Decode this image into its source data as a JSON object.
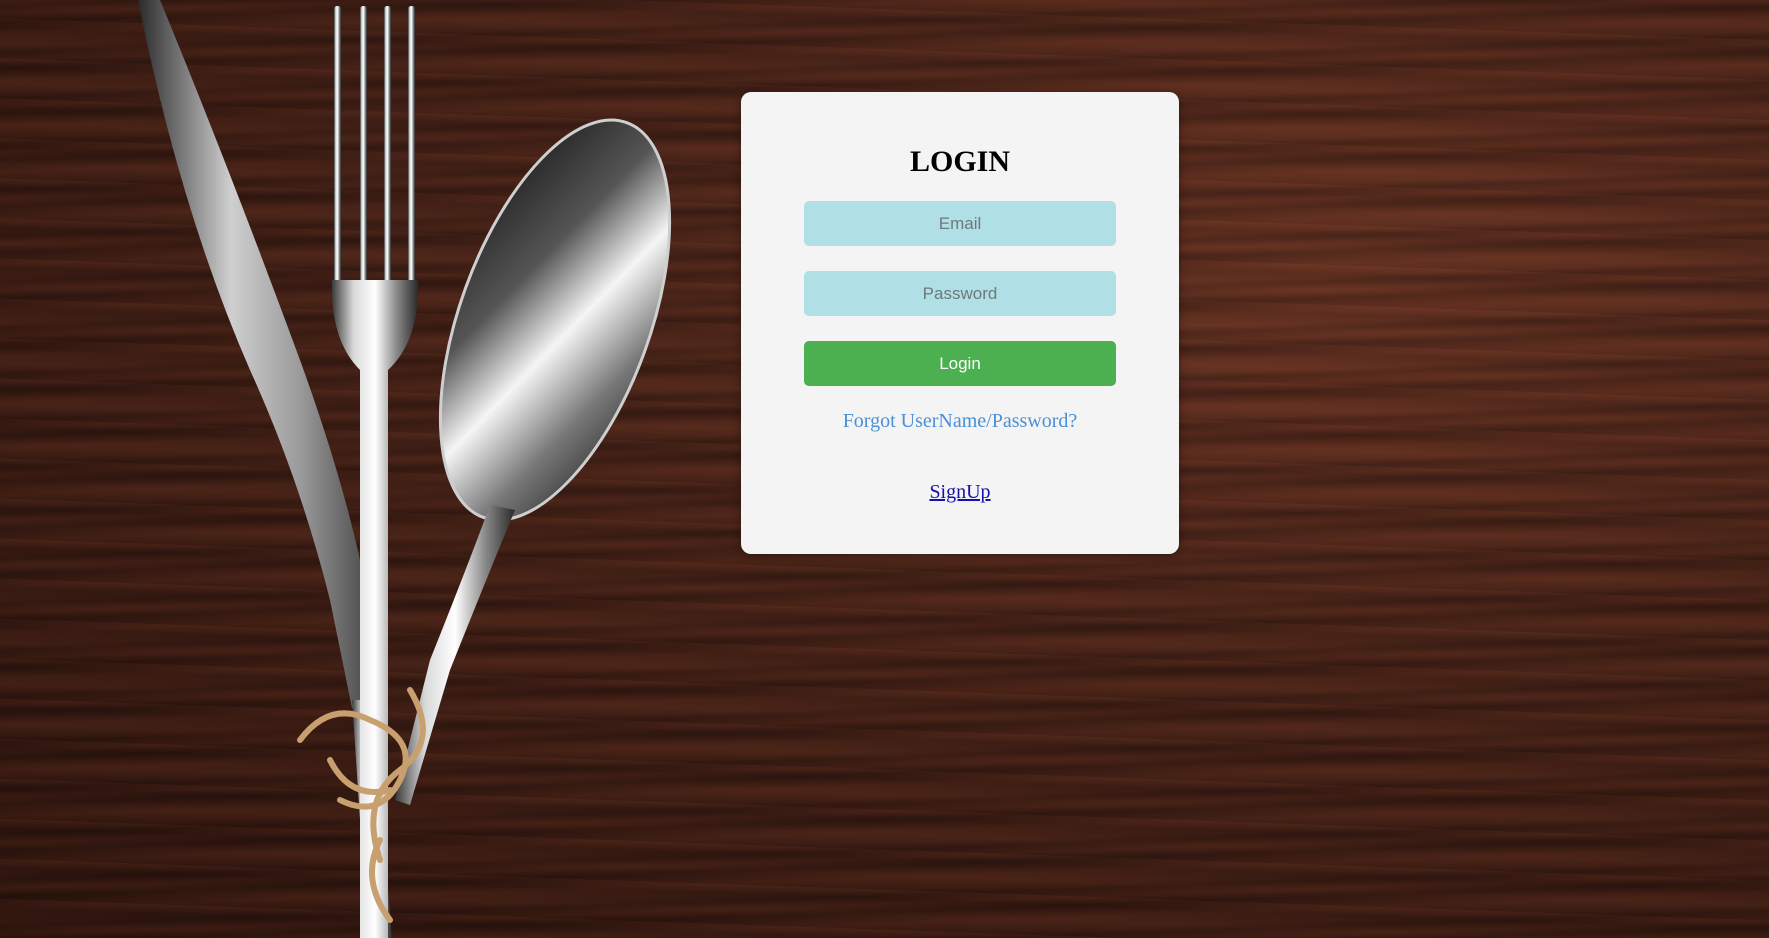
{
  "login_card": {
    "title": "LOGIN",
    "email_placeholder": "Email",
    "password_placeholder": "Password",
    "login_button_label": "Login",
    "forgot_link_text": "Forgot UserName/Password?",
    "signup_link_text": "SignUp"
  },
  "colors": {
    "card_background": "#f4f4f4",
    "input_background": "#b0e0e6",
    "login_button": "#4caf50",
    "forgot_link": "#4a8fd9",
    "signup_link": "#1a0dab"
  },
  "background": {
    "image_description_icon": "wooden-table-with-cutlery"
  }
}
